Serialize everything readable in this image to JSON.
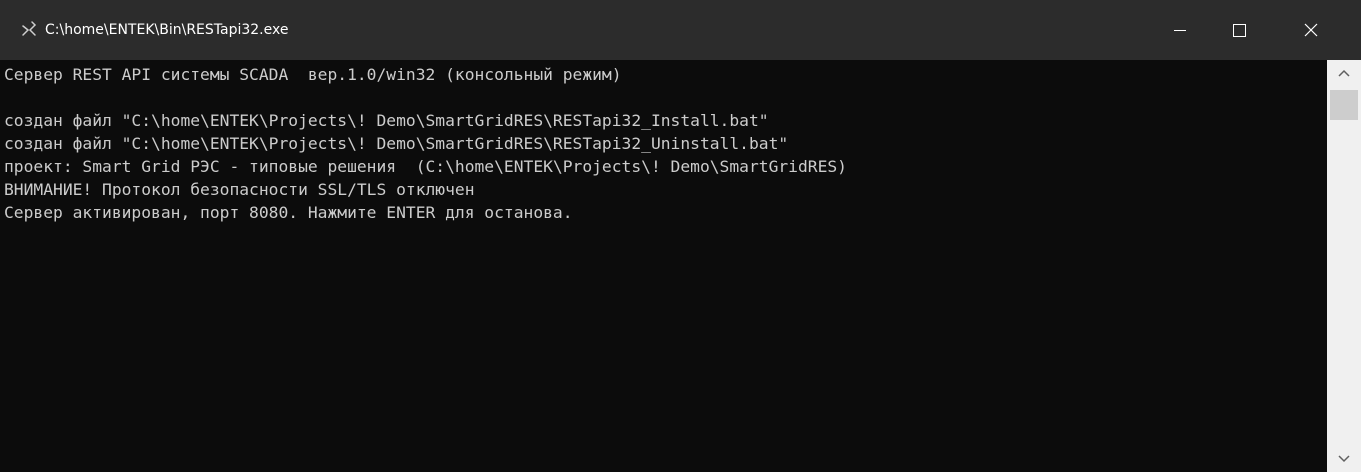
{
  "window": {
    "title": "C:\\home\\ENTEK\\Bin\\RESTapi32.exe",
    "controls": {
      "minimize_icon": "minimize-icon",
      "maximize_icon": "maximize-icon",
      "close_icon": "close-icon"
    }
  },
  "console": {
    "lines": [
      "Сервер REST API системы SCADA  вер.1.0/win32 (консольный режим)",
      "",
      "создан файл \"C:\\home\\ENTEK\\Projects\\! Demo\\SmartGridRES\\RESTapi32_Install.bat\"",
      "создан файл \"C:\\home\\ENTEK\\Projects\\! Demo\\SmartGridRES\\RESTapi32_Uninstall.bat\"",
      "проект: Smart Grid РЭС - типовые решения  (C:\\home\\ENTEK\\Projects\\! Demo\\SmartGridRES)",
      "ВНИМАНИЕ! Протокол безопасности SSL/TLS отключен",
      "Сервер активирован, порт 8080. Нажмите ENTER для останова."
    ]
  },
  "colors": {
    "titlebar": "#2c2c2c",
    "console_bg": "#0c0c0c",
    "console_text": "#cccccc",
    "scrollbar_track": "#f0f0f0",
    "scrollbar_thumb": "#cdcdcd"
  }
}
